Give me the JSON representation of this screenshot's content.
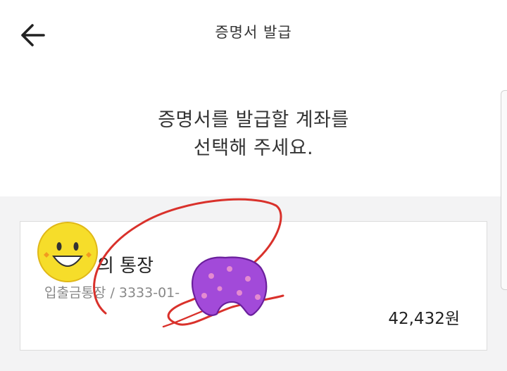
{
  "header": {
    "title": "증명서 발급",
    "back_icon": "arrow-left-icon"
  },
  "instruction": {
    "line1": "증명서를 발급할 계좌를",
    "line2": "선택해 주세요."
  },
  "account": {
    "name": "의 통장",
    "type_and_number": "입출금통장 / 3333-01-",
    "balance": "42,432원"
  },
  "colors": {
    "accent_scribble": "#d9312b",
    "sticker_yellow": "#f6dd2a",
    "sticker_purple": "#9a3bd6"
  }
}
